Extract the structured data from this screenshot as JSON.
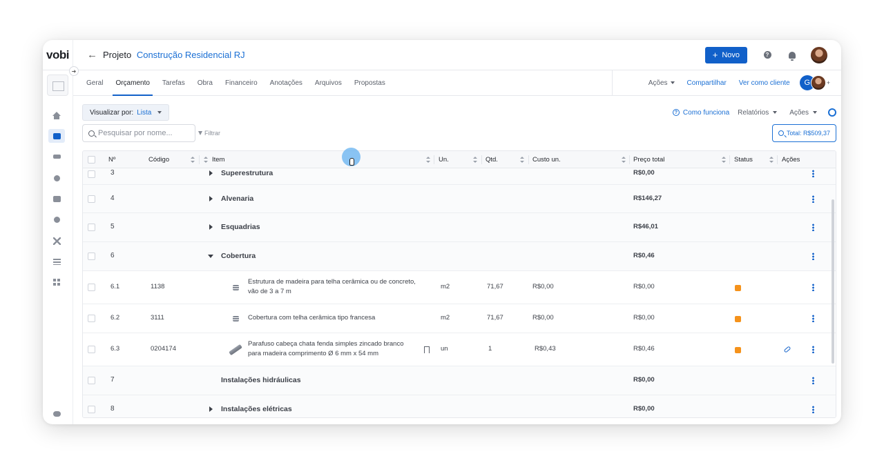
{
  "app": {
    "logo": "vobi"
  },
  "breadcrumb": {
    "prefix": "Projeto",
    "project": "Construção Residencial RJ"
  },
  "topbar": {
    "new_label": "Novo",
    "help": "?"
  },
  "colors": {
    "primary": "#1160c9",
    "link": "#1a6fd4",
    "status_orange": "#f5921b"
  },
  "sidebar": {
    "items": [
      {
        "icon": "home-icon"
      },
      {
        "icon": "folder-icon",
        "active": true
      },
      {
        "icon": "handshake-icon"
      },
      {
        "icon": "clock-icon"
      },
      {
        "icon": "box-icon"
      },
      {
        "icon": "dollar-icon"
      },
      {
        "icon": "tools-icon"
      },
      {
        "icon": "list-icon"
      },
      {
        "icon": "grid-icon"
      },
      {
        "icon": "chat-icon"
      }
    ]
  },
  "tabs": [
    {
      "label": "Geral"
    },
    {
      "label": "Orçamento",
      "active": true
    },
    {
      "label": "Tarefas"
    },
    {
      "label": "Obra"
    },
    {
      "label": "Financeiro"
    },
    {
      "label": "Anotações"
    },
    {
      "label": "Arquivos"
    },
    {
      "label": "Propostas"
    }
  ],
  "tab_actions": {
    "acoes": "Ações",
    "share": "Compartilhar",
    "view_as_client": "Ver como cliente",
    "avatar_initial": "G",
    "more": "+"
  },
  "toolbar": {
    "view_label": "Visualizar por:",
    "view_value": "Lista",
    "how_it_works": "Como funciona",
    "reports": "Relatórios",
    "actions": "Ações",
    "search_placeholder": "Pesquisar por nome...",
    "filter": "Filtrar",
    "total": "Total: R$509,37"
  },
  "table": {
    "headers": {
      "num": "Nº",
      "code": "Código",
      "item": "Item",
      "unit": "Un.",
      "qty": "Qtd.",
      "unit_cost": "Custo un.",
      "total_price": "Preço total",
      "status": "Status",
      "actions": "Ações"
    },
    "rows": [
      {
        "num": "3",
        "name": "Superestrutura",
        "total": "R$0,00"
      },
      {
        "num": "4",
        "name": "Alvenaria",
        "total": "R$146,27"
      },
      {
        "num": "5",
        "name": "Esquadrias",
        "total": "R$46,01"
      },
      {
        "num": "6",
        "name": "Cobertura",
        "total": "R$0,46"
      },
      {
        "num": "6.1",
        "code": "1138",
        "name": "Estrutura de madeira para telha cerâmica ou de concreto, vão de 3 a 7 m",
        "unit": "m2",
        "qty": "71,67",
        "unit_cost": "R$0,00",
        "total": "R$0,00"
      },
      {
        "num": "6.2",
        "code": "3111",
        "name": "Cobertura com telha cerâmica tipo francesa",
        "unit": "m2",
        "qty": "71,67",
        "unit_cost": "R$0,00",
        "total": "R$0,00"
      },
      {
        "num": "6.3",
        "code": "0204174",
        "name": "Parafuso cabeça chata fenda simples zincado branco para madeira comprimento Ø 6 mm x 54 mm",
        "unit": "un",
        "qty": "1",
        "unit_cost": "R$0,43",
        "total": "R$0,46"
      },
      {
        "num": "7",
        "name": "Instalações hidráulicas",
        "total": "R$0,00"
      },
      {
        "num": "8",
        "name": "Instalações elétricas",
        "total": "R$0,00"
      }
    ]
  }
}
